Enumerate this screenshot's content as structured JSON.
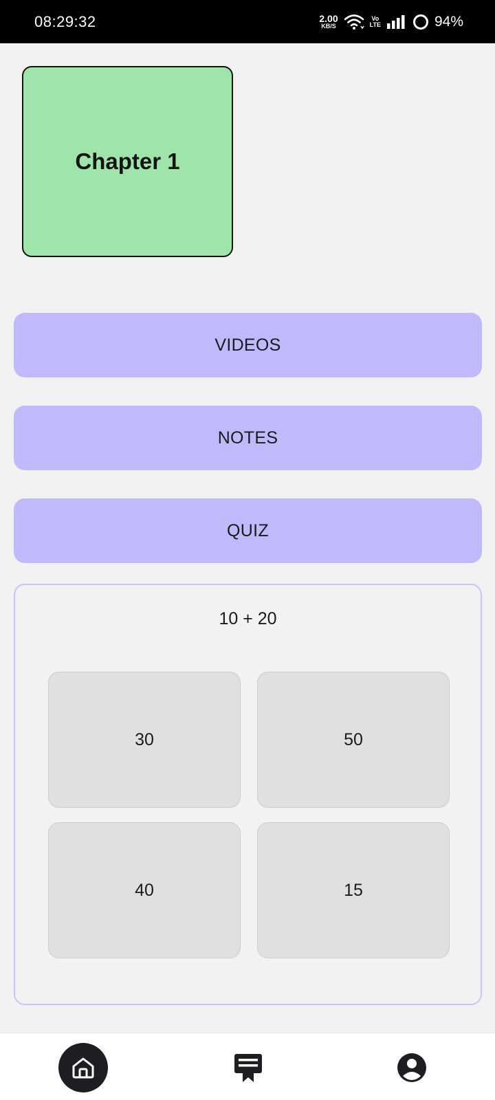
{
  "status_bar": {
    "time": "08:29:32",
    "net_speed_value": "2.00",
    "net_speed_unit": "KB/S",
    "volte_top": "Vo",
    "volte_bottom": "LTE",
    "battery": "94%"
  },
  "chapter": {
    "title": "Chapter 1",
    "color": "#9fe5ab"
  },
  "menu": {
    "videos_label": "VIDEOS",
    "notes_label": "NOTES",
    "quiz_label": "QUIZ",
    "accent": "#c0b9fc"
  },
  "quiz": {
    "question": "10 + 20",
    "options": [
      "30",
      "50",
      "40",
      "15"
    ]
  },
  "bottom_nav": {
    "items": [
      {
        "icon": "home-icon",
        "active": true
      },
      {
        "icon": "certificate-icon",
        "active": false
      },
      {
        "icon": "profile-icon",
        "active": false
      }
    ]
  }
}
